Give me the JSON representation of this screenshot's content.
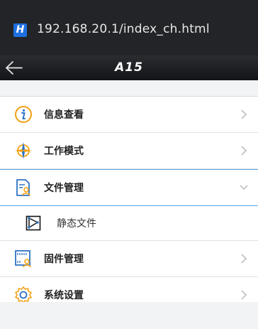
{
  "browser": {
    "url": "192.168.20.1/index_ch.html",
    "site_badge": "H"
  },
  "appbar": {
    "brand": "A15"
  },
  "menu": {
    "info": {
      "label": "信息查看",
      "icon": "info-icon"
    },
    "work_mode": {
      "label": "工作模式",
      "icon": "compass-icon"
    },
    "file_mgmt": {
      "label": "文件管理",
      "icon": "file-user-icon"
    },
    "static_file": {
      "label": "静态文件",
      "icon": "static-file-icon"
    },
    "firmware": {
      "label": "固件管理",
      "icon": "firmware-icon"
    },
    "settings": {
      "label": "系统设置",
      "icon": "gear-icon"
    }
  },
  "colors": {
    "accent": "#f2a012",
    "icon_blue": "#2f73c5",
    "chevron": "#b8b8b8"
  }
}
